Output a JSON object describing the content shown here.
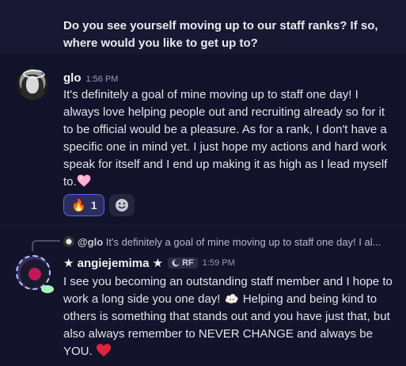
{
  "top_message": {
    "text": "Do you see yourself moving up to our staff ranks? If so, where would you like to get up to?"
  },
  "message1": {
    "username": "glo",
    "timestamp": "1:56 PM",
    "body": "It's definitely a goal of mine moving up to staff one day! I always love helping people out and recruiting already so for it to be official would be a pleasure. As for a rank, I don't have a specific one in mind yet. I just hope my actions and hard work speak for itself and I end up making it as high as I lead myself to.",
    "reaction": {
      "emoji": "🔥",
      "count": "1"
    },
    "add_reaction_icon": "smiley-icon"
  },
  "message2": {
    "reply": {
      "mention": "@glo",
      "snippet": "It's definitely a goal of mine moving up to staff one day! I al..."
    },
    "username": "★ angiejemima ★",
    "guild_tag": "RF",
    "timestamp": "1:59 PM",
    "body_part1": "I see you becoming an outstanding staff member and I hope to work a long side you one day!",
    "body_part2": "Helping and being kind to others is something that stands out and you have just that, but also always remember to NEVER CHANGE and always be YOU."
  },
  "colors": {
    "background": "#14142a",
    "reaction_border": "#5865f2",
    "heart_red": "#e0243a",
    "heart_pink": "#ff9ec8"
  }
}
